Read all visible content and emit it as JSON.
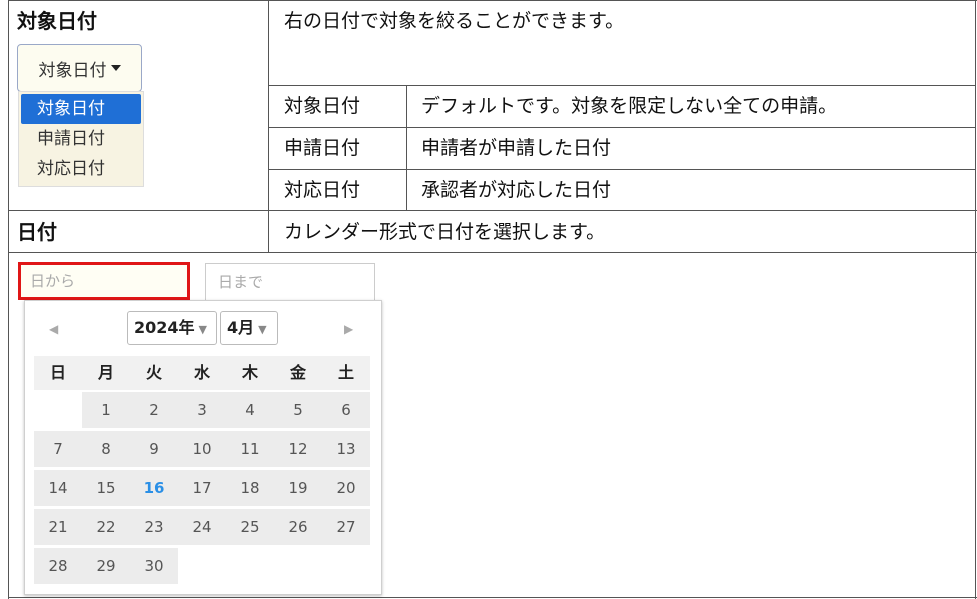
{
  "rows": {
    "target_date": {
      "title": "対象日付",
      "description": "右の日付で対象を絞ることができます。"
    },
    "date": {
      "title": "日付",
      "description": "カレンダー形式で日付を選択します。"
    }
  },
  "options_table": [
    {
      "name": "対象日付",
      "desc": "デフォルトです。対象を限定しない全ての申請。"
    },
    {
      "name": "申請日付",
      "desc": "申請者が申請した日付"
    },
    {
      "name": "対応日付",
      "desc": "承認者が対応した日付"
    }
  ],
  "dropdown": {
    "button_label": "対象日付",
    "items": [
      "対象日付",
      "申請日付",
      "対応日付"
    ],
    "selected_index": 0
  },
  "date_range": {
    "from_placeholder": "日から",
    "to_placeholder": "日まで"
  },
  "calendar": {
    "year_label": "2024年",
    "month_label": "4月",
    "prev_icon": "triangle-left",
    "next_icon": "triangle-right",
    "weekdays": [
      "日",
      "月",
      "火",
      "水",
      "木",
      "金",
      "土"
    ],
    "weeks": [
      [
        "",
        "1",
        "2",
        "3",
        "4",
        "5",
        "6"
      ],
      [
        "7",
        "8",
        "9",
        "10",
        "11",
        "12",
        "13"
      ],
      [
        "14",
        "15",
        "16",
        "17",
        "18",
        "19",
        "20"
      ],
      [
        "21",
        "22",
        "23",
        "24",
        "25",
        "26",
        "27"
      ],
      [
        "28",
        "29",
        "30",
        "",
        "",
        "",
        ""
      ]
    ],
    "today": "16"
  },
  "colors": {
    "selected_item": "#1f6fd6",
    "highlight_border": "#e01616",
    "today": "#2a8fe6"
  }
}
